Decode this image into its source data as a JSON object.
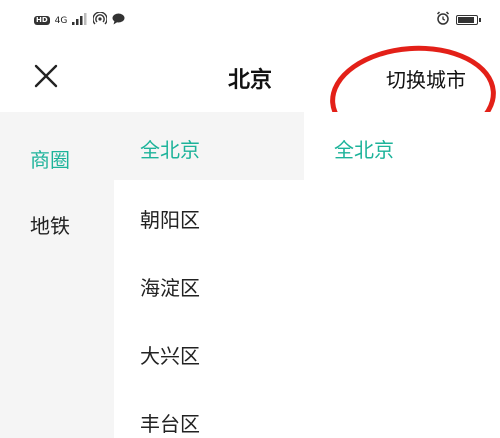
{
  "status_bar": {
    "hd": "HD",
    "network": "4G",
    "battery_level": 0.8
  },
  "header": {
    "title": "北京",
    "switch_city_label": "切换城市"
  },
  "colors": {
    "accent": "#1db39a",
    "annotation": "#e32018",
    "sidebar_bg": "#f5f5f5"
  },
  "categories": [
    {
      "label": "商圈",
      "active": true
    },
    {
      "label": "地铁",
      "active": false
    }
  ],
  "districts": [
    {
      "label": "全北京",
      "active": true
    },
    {
      "label": "朝阳区",
      "active": false
    },
    {
      "label": "海淀区",
      "active": false
    },
    {
      "label": "大兴区",
      "active": false
    },
    {
      "label": "丰台区",
      "active": false
    }
  ],
  "sub_areas": [
    {
      "label": "全北京",
      "active": true
    }
  ]
}
